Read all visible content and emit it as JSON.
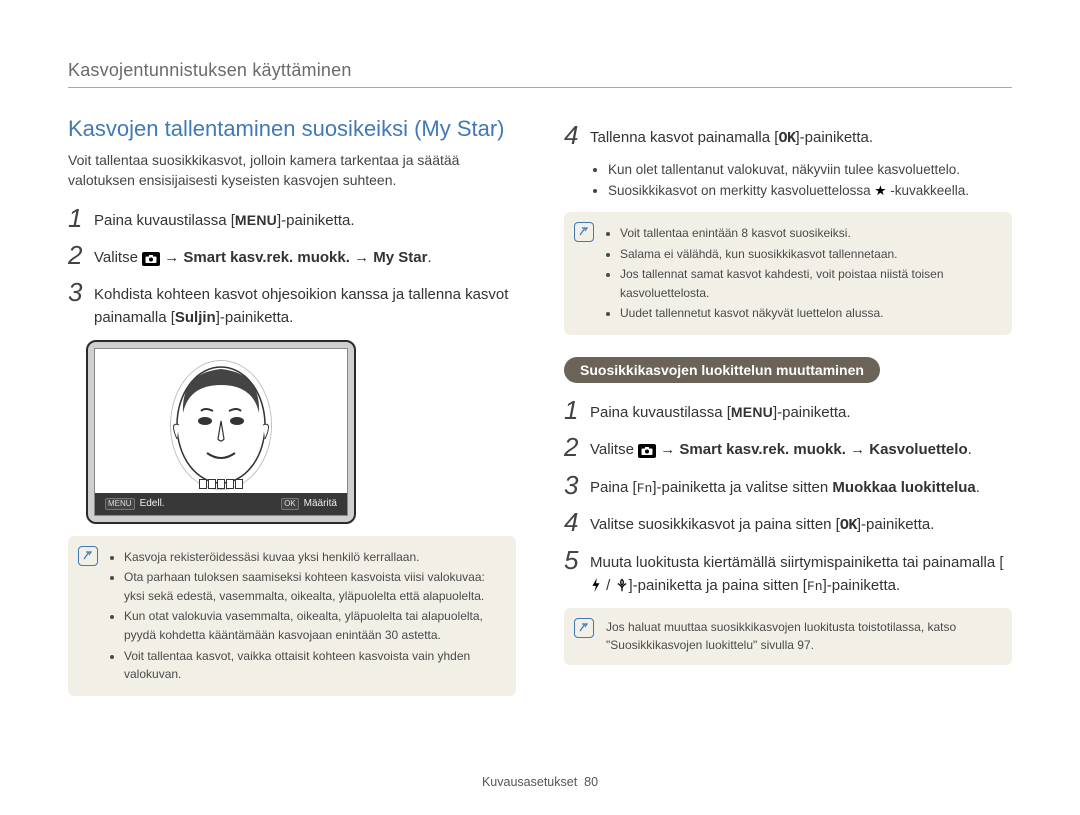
{
  "header": {
    "title": "Kasvojentunnistuksen käyttäminen"
  },
  "section": {
    "title": "Kasvojen tallentaminen suosikeiksi (My Star)",
    "intro": "Voit tallentaa suosikkikasvot, jolloin kamera tarkentaa ja säätää valotuksen ensisijaisesti kyseisten kasvojen suhteen."
  },
  "left_steps": {
    "s1_a": "Paina kuvaustilassa [",
    "s1_menu": "MENU",
    "s1_b": "]-painiketta.",
    "s2_a": "Valitse ",
    "s2_b": " → ",
    "s2_bold1": "Smart kasv.rek. muokk.",
    "s2_c": " → ",
    "s2_bold2": "My Star",
    "s2_d": ".",
    "s3_a": "Kohdista kohteen kasvot ohjesoikion kanssa ja tallenna kasvot painamalla [",
    "s3_bold": "Suljin",
    "s3_b": "]-painiketta."
  },
  "lcd": {
    "back_label": "Edell.",
    "set_label": "Määritä",
    "back_btn": "MENU",
    "set_btn": "OK"
  },
  "left_note": {
    "b1": "Kasvoja rekisteröidessäsi kuvaa yksi henkilö kerrallaan.",
    "b2": "Ota parhaan tuloksen saamiseksi kohteen kasvoista viisi valokuvaa: yksi sekä edestä, vasemmalta, oikealta, yläpuolelta että alapuolelta.",
    "b3": "Kun otat valokuvia vasemmalta, oikealta, yläpuolelta tai alapuolelta, pyydä kohdetta kääntämään kasvojaan enintään 30 astetta.",
    "b4": "Voit tallentaa kasvot, vaikka ottaisit kohteen kasvoista vain yhden valokuvan."
  },
  "right_step4": {
    "a": "Tallenna kasvot painamalla [",
    "ok": "OK",
    "b": "]-painiketta."
  },
  "right_sub": {
    "b1": "Kun olet tallentanut valokuvat, näkyviin tulee kasvoluettelo.",
    "b2_a": "Suosikkikasvot on merkitty kasvoluettelossa ",
    "b2_b": " -kuvakkeella."
  },
  "right_note": {
    "b1": "Voit tallentaa enintään 8 kasvot suosikeiksi.",
    "b2": "Salama ei välähdä, kun suosikkikasvot tallennetaan.",
    "b3": "Jos tallennat samat kasvot kahdesti, voit poistaa niistä toisen kasvoluettelosta.",
    "b4": "Uudet tallennetut kasvot näkyvät luettelon alussa."
  },
  "pill": {
    "label": "Suosikkikasvojen luokittelun muuttaminen"
  },
  "right_steps": {
    "s1_a": "Paina kuvaustilassa [",
    "s1_menu": "MENU",
    "s1_b": "]-painiketta.",
    "s2_a": "Valitse ",
    "s2_b": " → ",
    "s2_bold1": "Smart kasv.rek. muokk.",
    "s2_c": " → ",
    "s2_bold2": "Kasvoluettelo",
    "s2_d": ".",
    "s3_a": "Paina [",
    "s3_fn": "Fn",
    "s3_b": "]-painiketta ja valitse sitten ",
    "s3_bold": "Muokkaa luokittelua",
    "s3_c": ".",
    "s4_a": "Valitse suosikkikasvot ja paina sitten [",
    "s4_ok": "OK",
    "s4_b": "]-painiketta.",
    "s5_a": "Muuta luokitusta kiertämällä siirtymispainiketta tai painamalla [",
    "s5_b": "]-painiketta ja paina sitten [",
    "s5_fn": "Fn",
    "s5_c": "]-painiketta."
  },
  "right_bottom_note": {
    "a": "Jos haluat muuttaa suosikkikasvojen luokitusta toistotilassa, katso \"Suosikkikasvojen luokittelu\" sivulla 97."
  },
  "footer": {
    "label": "Kuvausasetukset",
    "page": "80"
  }
}
